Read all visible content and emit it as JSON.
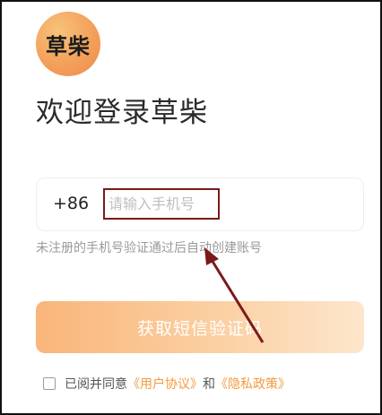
{
  "logo": {
    "text": "草柴"
  },
  "title": "欢迎登录草柴",
  "phone": {
    "country_code": "+86",
    "placeholder": "请输入手机号"
  },
  "hint": "未注册的手机号验证通过后自动创建账号",
  "cta": {
    "label": "获取短信验证码"
  },
  "agreement": {
    "prefix": "已阅并同意",
    "user_agreement": "《用户协议》",
    "and": "和",
    "privacy_policy": "《隐私政策》"
  },
  "colors": {
    "accent": "#f29a3f",
    "annotation": "#7a1a1a"
  }
}
